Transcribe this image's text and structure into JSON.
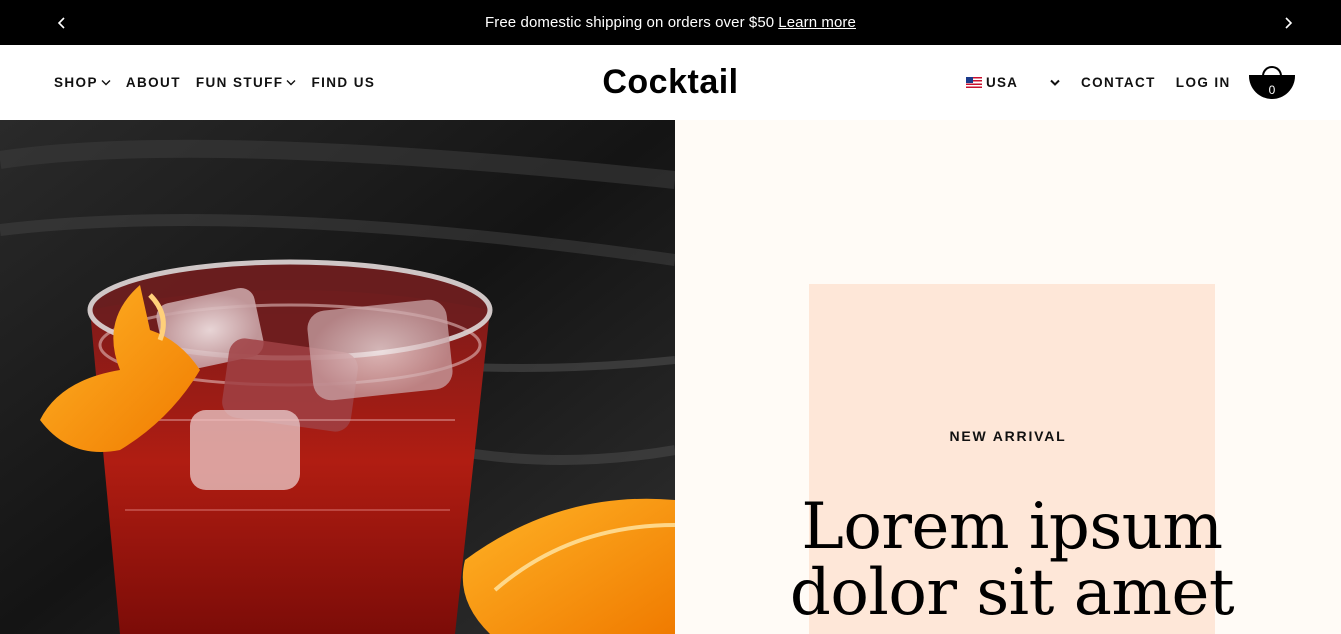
{
  "announcement": {
    "message": "Free domestic shipping on orders over $50",
    "link_label": "Learn more",
    "prev_icon": "chevron-left-icon",
    "next_icon": "chevron-right-icon"
  },
  "header": {
    "logo": "Cocktail",
    "nav_left": [
      {
        "label": "SHOP",
        "has_dropdown": true
      },
      {
        "label": "ABOUT",
        "has_dropdown": false
      },
      {
        "label": "FUN STUFF",
        "has_dropdown": true
      },
      {
        "label": "FIND US",
        "has_dropdown": false
      }
    ],
    "country": {
      "label": "USA",
      "flag_icon": "us-flag-icon"
    },
    "contact_label": "CONTACT",
    "login_label": "LOG IN",
    "cart": {
      "icon": "cocktail-glass-cart-icon",
      "count": "0"
    }
  },
  "hero": {
    "eyebrow": "NEW ARRIVAL",
    "headline_line1": "Lorem ipsum",
    "headline_line2": "dolor sit amet",
    "colors": {
      "panel_bg": "#fffbf6",
      "peach_block": "#fee7d8"
    }
  }
}
